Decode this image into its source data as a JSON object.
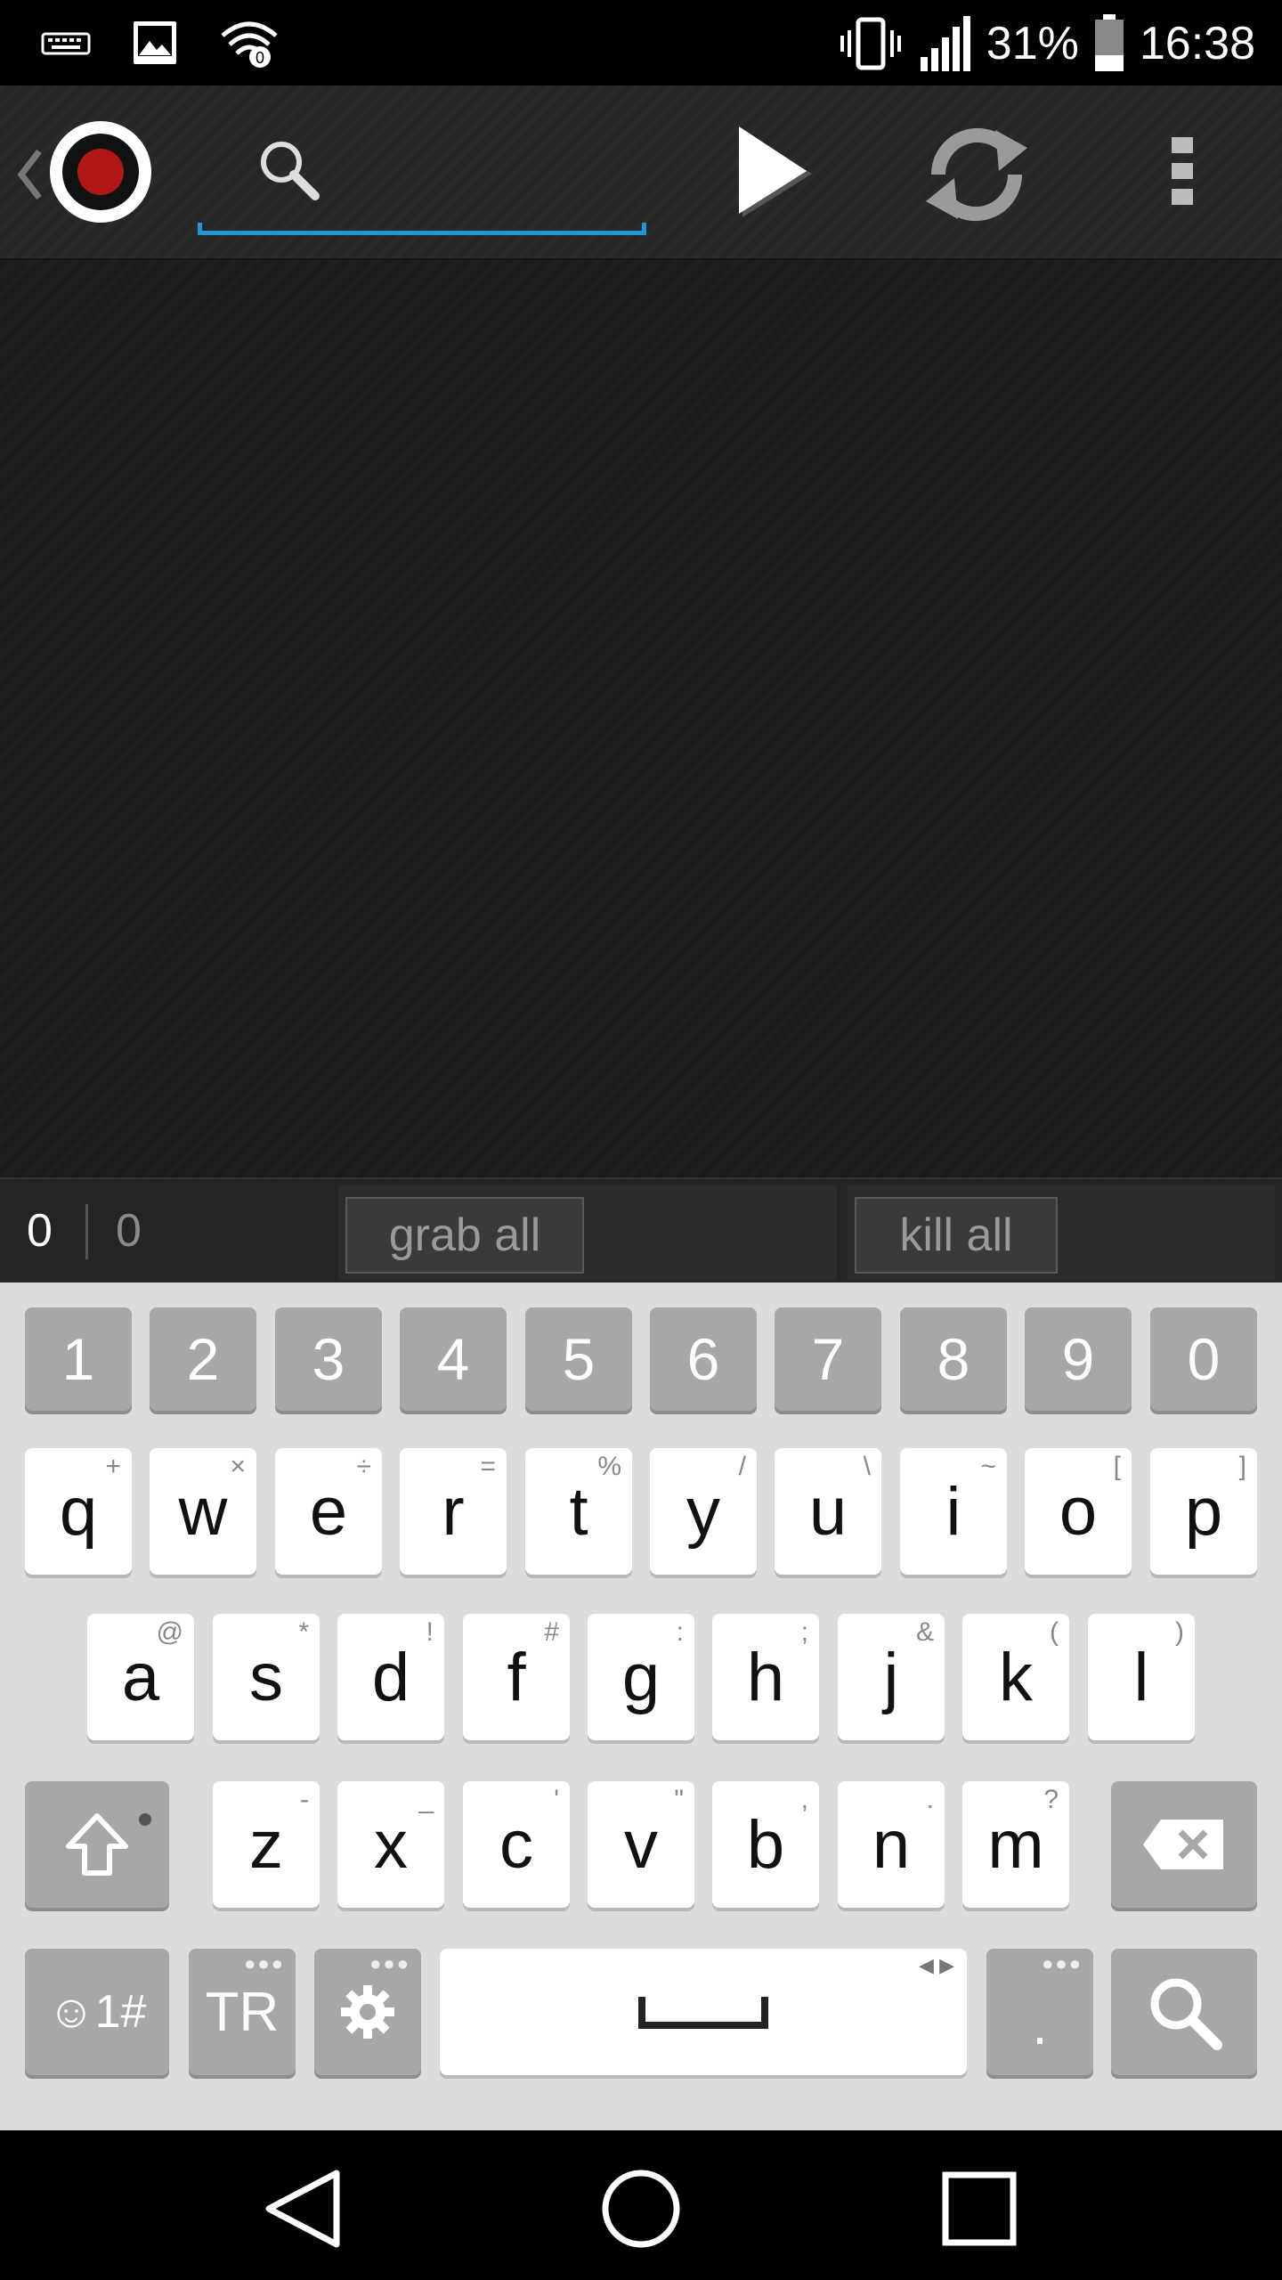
{
  "status_bar": {
    "battery": "31%",
    "time": "16:38"
  },
  "toolbar": {
    "search_placeholder": ""
  },
  "bottom_bar": {
    "count_left": "0",
    "count_right": "0",
    "grab_all": "grab all",
    "kill_all": "kill all"
  },
  "keyboard": {
    "numbers": [
      "1",
      "2",
      "3",
      "4",
      "5",
      "6",
      "7",
      "8",
      "9",
      "0"
    ],
    "row1": [
      {
        "key": "q",
        "alt": "+"
      },
      {
        "key": "w",
        "alt": "×"
      },
      {
        "key": "e",
        "alt": "÷"
      },
      {
        "key": "r",
        "alt": "="
      },
      {
        "key": "t",
        "alt": "%"
      },
      {
        "key": "y",
        "alt": "/"
      },
      {
        "key": "u",
        "alt": "\\"
      },
      {
        "key": "i",
        "alt": "~"
      },
      {
        "key": "o",
        "alt": "["
      },
      {
        "key": "p",
        "alt": "]"
      }
    ],
    "row2": [
      {
        "key": "a",
        "alt": "@"
      },
      {
        "key": "s",
        "alt": "*"
      },
      {
        "key": "d",
        "alt": "!"
      },
      {
        "key": "f",
        "alt": "#"
      },
      {
        "key": "g",
        "alt": ":"
      },
      {
        "key": "h",
        "alt": ";"
      },
      {
        "key": "j",
        "alt": "&"
      },
      {
        "key": "k",
        "alt": "("
      },
      {
        "key": "l",
        "alt": ")"
      }
    ],
    "row3": [
      {
        "key": "z",
        "alt": "-"
      },
      {
        "key": "x",
        "alt": "_"
      },
      {
        "key": "c",
        "alt": "'"
      },
      {
        "key": "v",
        "alt": "\""
      },
      {
        "key": "b",
        "alt": ","
      },
      {
        "key": "n",
        "alt": "."
      },
      {
        "key": "m",
        "alt": "?"
      }
    ],
    "symbols_label": "☺1#",
    "language_label": "TR",
    "period_label": "."
  }
}
